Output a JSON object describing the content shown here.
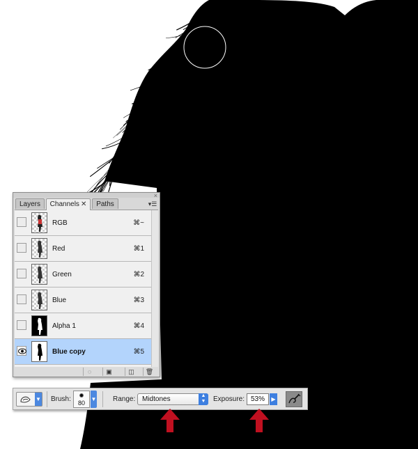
{
  "panel": {
    "tabs": [
      {
        "label": "Layers",
        "active": false
      },
      {
        "label": "Channels",
        "active": true,
        "close_glyph": "✕"
      },
      {
        "label": "Paths",
        "active": false
      }
    ],
    "close_glyph": "×",
    "menu_glyph": "▾☰",
    "channels": [
      {
        "name": "RGB",
        "shortcut": "⌘~",
        "visible": false,
        "selected": false,
        "thumb": "color-figure"
      },
      {
        "name": "Red",
        "shortcut": "⌘1",
        "visible": false,
        "selected": false,
        "thumb": "gray-figure"
      },
      {
        "name": "Green",
        "shortcut": "⌘2",
        "visible": false,
        "selected": false,
        "thumb": "gray-figure"
      },
      {
        "name": "Blue",
        "shortcut": "⌘3",
        "visible": false,
        "selected": false,
        "thumb": "gray-figure"
      },
      {
        "name": "Alpha 1",
        "shortcut": "⌘4",
        "visible": false,
        "selected": false,
        "thumb": "white-silhouette"
      },
      {
        "name": "Blue copy",
        "shortcut": "⌘5",
        "visible": true,
        "selected": true,
        "thumb": "black-silhouette"
      }
    ],
    "bottom_buttons": [
      {
        "name": "load-selection-icon",
        "glyph": "◌"
      },
      {
        "name": "save-selection-icon",
        "glyph": "▣"
      },
      {
        "name": "new-channel-icon",
        "glyph": "◫"
      },
      {
        "name": "trash-icon",
        "glyph": "🗑"
      }
    ]
  },
  "options_bar": {
    "tool_icon": "dodge-tool-icon",
    "brush_label": "Brush:",
    "brush_size": "80",
    "range_label": "Range:",
    "range_value": "Midtones",
    "exposure_label": "Exposure:",
    "exposure_value": "53%",
    "airbrush_icon": "airbrush-icon"
  },
  "colors": {
    "selection_highlight": "#b3d4fc",
    "dropdown_blue": "#3d7fe0",
    "annotation_arrow": "#c01020",
    "canvas_black": "#000000"
  }
}
